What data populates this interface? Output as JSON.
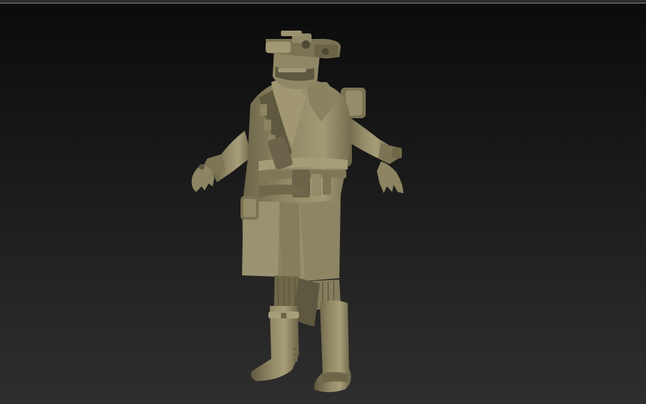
{
  "viewport": {
    "background_top": "#0b0b0b",
    "background_bottom": "#2e2e2e",
    "frame_line_color": "#8a8a8a"
  },
  "model": {
    "material_color": "#8a8160",
    "highlight_color": "#b5ad88",
    "shadow_color": "#4e4833",
    "pose": "T-pose"
  }
}
